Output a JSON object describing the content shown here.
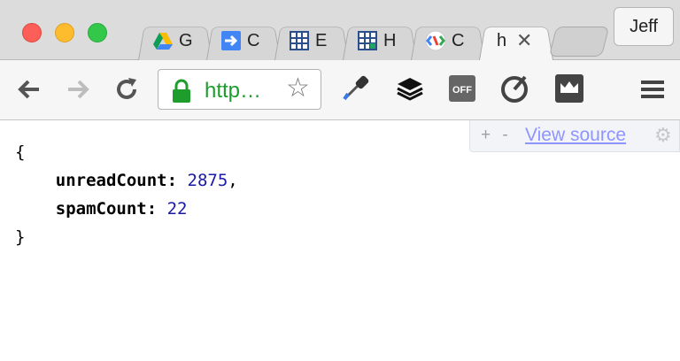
{
  "window": {
    "profile_name": "Jeff"
  },
  "tabs": [
    {
      "title": "G",
      "icon": "google-drive-icon"
    },
    {
      "title": "C",
      "icon": "arrow-right-icon"
    },
    {
      "title": "E",
      "icon": "spreadsheet-icon"
    },
    {
      "title": "H",
      "icon": "spreadsheet-icon"
    },
    {
      "title": "C",
      "icon": "chrome-apps-icon"
    },
    {
      "title": "h",
      "icon": "close-icon",
      "active": true
    }
  ],
  "toolbar": {
    "url_text": "http…",
    "extensions": [
      "eyedropper-icon",
      "layers-icon",
      "off-icon",
      "gauge-icon",
      "crown-icon"
    ]
  },
  "viewer": {
    "plus_minus": "+ -",
    "view_source": "View source"
  },
  "json_view": {
    "open_brace": "{",
    "close_brace": "}",
    "entries": [
      {
        "key": "unreadCount:",
        "value": "2875",
        "suffix": ","
      },
      {
        "key": "spamCount:",
        "value": "22",
        "suffix": ""
      }
    ]
  },
  "colors": {
    "url_green": "#1e9c2c",
    "json_number": "#1a1aa6",
    "view_source_link": "#8f95ff"
  }
}
